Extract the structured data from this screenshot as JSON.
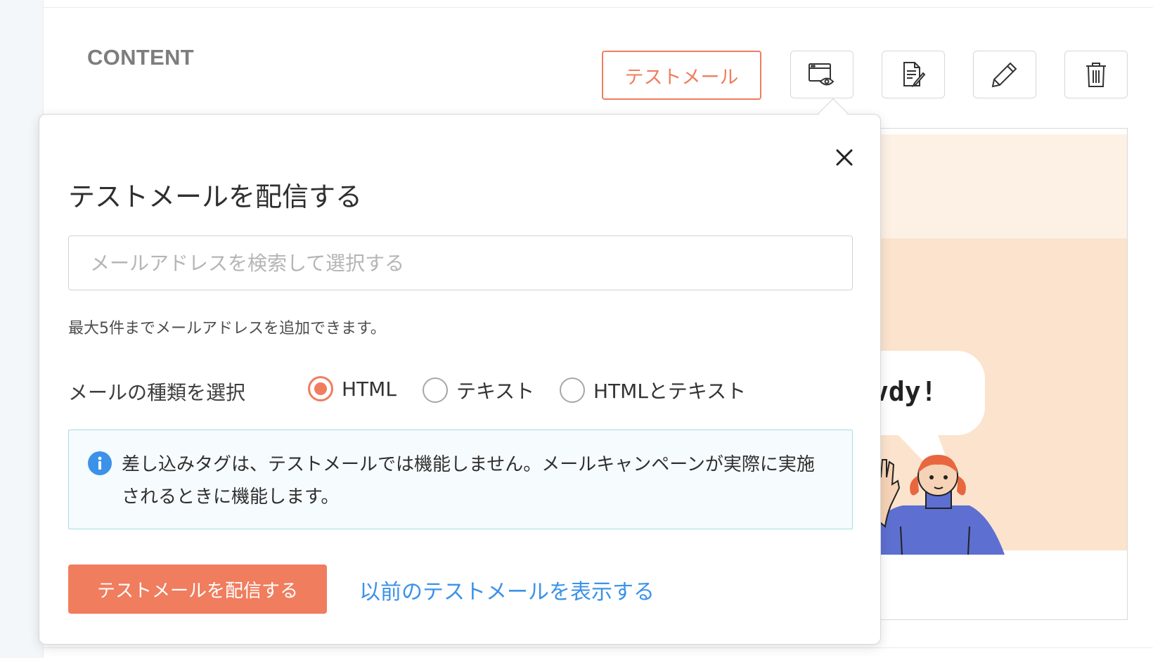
{
  "header": {
    "section_title": "CONTENT",
    "test_mail_button": "テストメール"
  },
  "toolbar": {
    "icons": [
      "preview-icon",
      "source-edit-icon",
      "pencil-icon",
      "trash-icon"
    ]
  },
  "preview": {
    "bubble_text": "vdy!"
  },
  "popover": {
    "title": "テストメールを配信する",
    "email_placeholder": "メールアドレスを検索して選択する",
    "email_value": "",
    "hint": "最大5件までメールアドレスを追加できます。",
    "type_label": "メールの種類を選択",
    "type_options": [
      {
        "label": "HTML",
        "selected": true
      },
      {
        "label": "テキスト",
        "selected": false
      },
      {
        "label": "HTMLとテキスト",
        "selected": false
      }
    ],
    "info_message": "差し込みタグは、テストメールでは機能しません。メールキャンペーンが実際に実施されるときに機能します。",
    "submit_button": "テストメールを配信する",
    "history_link": "以前のテストメールを表示する"
  },
  "colors": {
    "accent": "#ef7d5e",
    "link": "#3b92e8",
    "info_border": "#a8dce6",
    "info_bg": "#f6fbfd"
  }
}
